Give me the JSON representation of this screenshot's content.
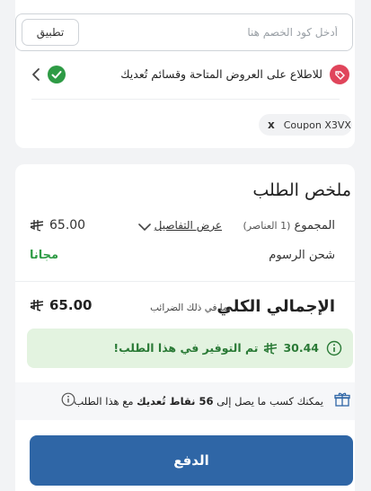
{
  "coupon": {
    "placeholder": "أدخل كود الخصم هنا",
    "apply_label": "تطبيق",
    "promo_text": "للاطلاع على العروض المتاحة وقسائم تُعديك",
    "applied_code": "Coupon X3VX",
    "remove_label": "x"
  },
  "summary": {
    "title": "ملخص الطلب",
    "subtotal_label": "المجموع",
    "items_count": "(1 العناصر)",
    "details_link": "عرض التفاصيل",
    "subtotal_value": "65.00",
    "shipping_label": "شحن الرسوم",
    "shipping_value": "مجانا",
    "total_label": "الإجمالي الكلي",
    "total_sub": "بما في ذلك الضرائب",
    "total_value": "65.00"
  },
  "savings": {
    "amount": "30.44",
    "text": "تم التوفير في هذا الطلب!"
  },
  "points": {
    "prefix": "يمكنك كسب ما يصل إلى",
    "points_value": "56 نقاط تُعديك",
    "suffix": "مع هذا الطلب"
  },
  "pay": {
    "label": "الدفع"
  },
  "colors": {
    "accent": "#2f66a6",
    "success": "#2e9b45",
    "savings_bg": "#e3f3e0",
    "promo_icon": "#e0455b"
  }
}
